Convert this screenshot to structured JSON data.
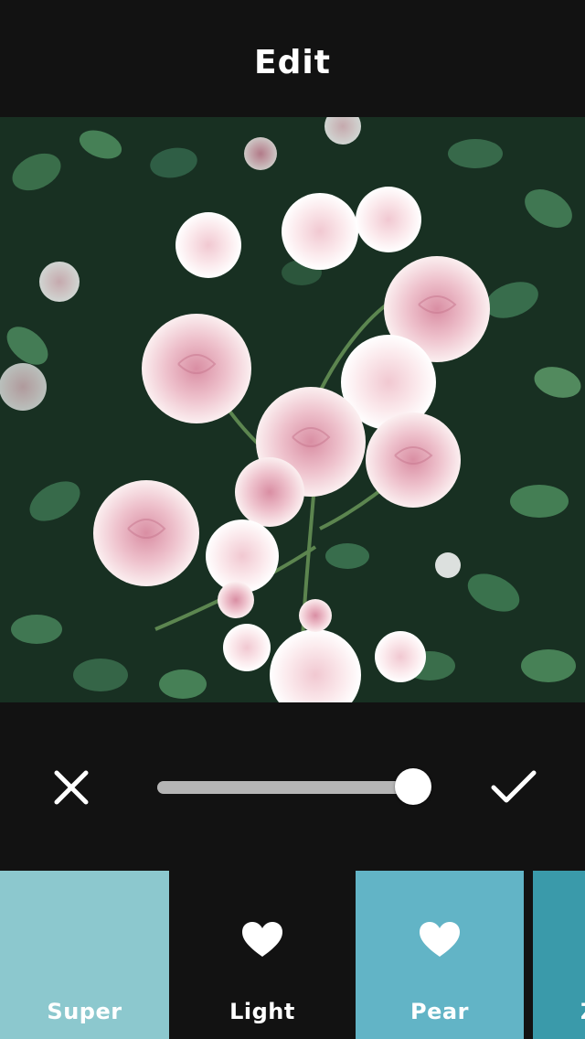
{
  "header": {
    "title": "Edit"
  },
  "editor": {
    "slider_value": 1.0
  },
  "icons": {
    "cancel": "close-icon",
    "confirm": "checkmark-icon",
    "favorite": "heart-icon"
  },
  "filters": [
    {
      "label": "Super",
      "color": "#8cc8ce",
      "favorite": false
    },
    {
      "label": "Light",
      "color": "#121212",
      "favorite": true,
      "selected": true
    },
    {
      "label": "Pear",
      "color": "#62b4c6",
      "favorite": true
    },
    {
      "label": "Z",
      "color": "#3a9aaa",
      "favorite": false
    }
  ],
  "colors": {
    "background": "#121212",
    "slider_fill": "#b5b5b5",
    "slider_track": "#3a3a3a",
    "text": "#ffffff"
  }
}
